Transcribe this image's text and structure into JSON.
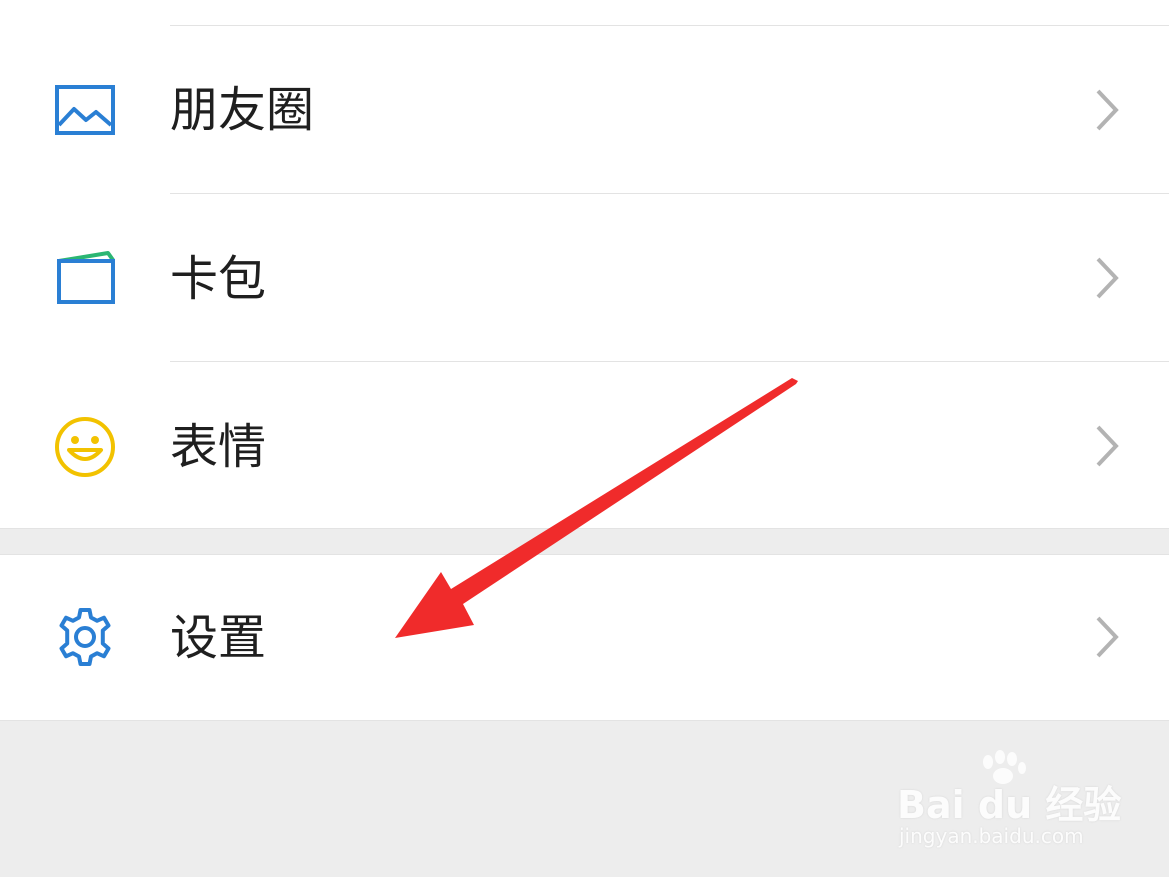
{
  "menu": {
    "items": [
      {
        "label": "朋友圈",
        "icon": "moments-image-icon"
      },
      {
        "label": "卡包",
        "icon": "card-wallet-icon"
      },
      {
        "label": "表情",
        "icon": "smiley-face-icon"
      },
      {
        "label": "设置",
        "icon": "gear-icon"
      }
    ]
  },
  "watermark": {
    "brand": "Bai du 经验",
    "url": "jingyan.baidu.com"
  },
  "colors": {
    "icon_blue": "#2a7fd4",
    "icon_yellow": "#f2c200",
    "icon_green": "#2bb673",
    "arrow_red": "#f02b2b",
    "chevron_gray": "#b3b3b3",
    "background": "#ededed"
  }
}
